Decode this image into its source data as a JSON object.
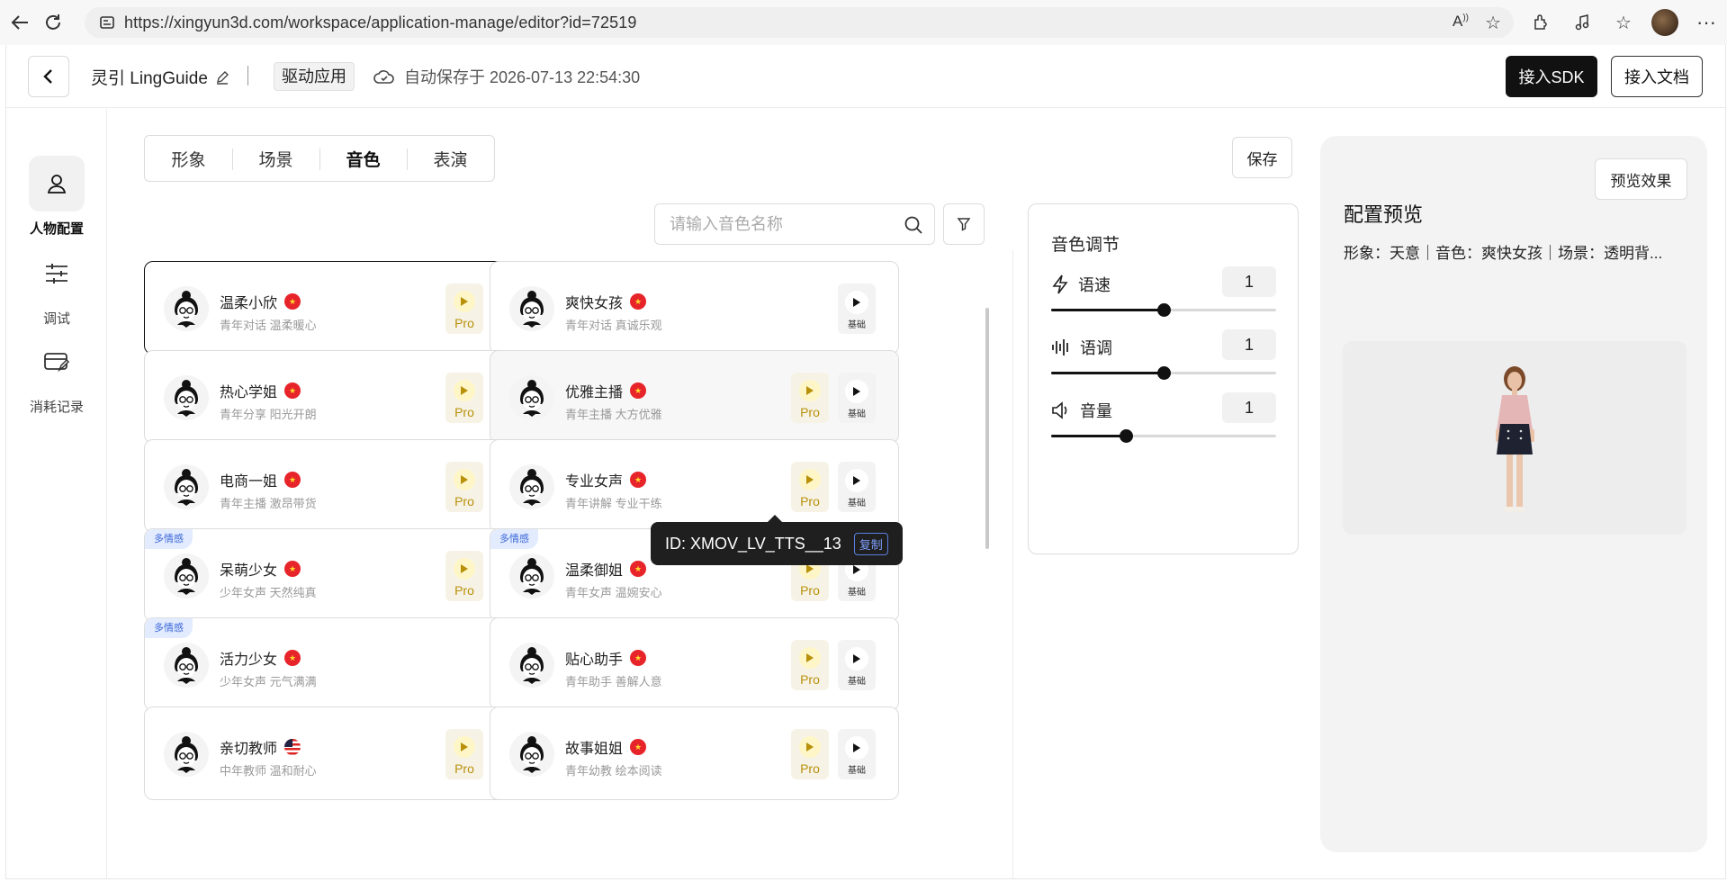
{
  "browser": {
    "url": "https://xingyun3d.com/workspace/application-manage/editor?id=72519"
  },
  "header": {
    "app_name": "灵引 LingGuide",
    "tag": "驱动应用",
    "autosave": "自动保存于 2026-07-13 22:54:30",
    "sdk_button": "接入SDK",
    "doc_button": "接入文档"
  },
  "left_nav": {
    "items": [
      {
        "label": "人物配置",
        "icon": "person-icon",
        "active": true
      },
      {
        "label": "调试",
        "icon": "sliders-icon",
        "active": false
      },
      {
        "label": "消耗记录",
        "icon": "card-edit-icon",
        "active": false
      }
    ]
  },
  "tabs": [
    {
      "label": "形象",
      "active": false
    },
    {
      "label": "场景",
      "active": false
    },
    {
      "label": "音色",
      "active": true
    },
    {
      "label": "表演",
      "active": false
    }
  ],
  "save_button": "保存",
  "search": {
    "placeholder": "请输入音色名称",
    "value": ""
  },
  "voices": [
    {
      "name": "温柔小欣",
      "desc": "青年对话 温柔暖心",
      "flag": "cn",
      "pro": true,
      "multi": false,
      "selected": true,
      "playing": true
    },
    {
      "name": "爽快女孩",
      "desc": "青年对话 真诚乐观",
      "flag": "cn",
      "pro": false,
      "multi": false
    },
    {
      "name": "热心学姐",
      "desc": "青年分享 阳光开朗",
      "flag": "cn",
      "pro": true,
      "multi": false
    },
    {
      "name": "优雅主播",
      "desc": "青年主播 大方优雅",
      "flag": "cn",
      "pro": true,
      "multi": false,
      "hover": true
    },
    {
      "name": "电商一姐",
      "desc": "青年主播 激昂带货",
      "flag": "cn",
      "pro": true,
      "multi": false
    },
    {
      "name": "专业女声",
      "desc": "青年讲解 专业干练",
      "flag": "cn",
      "pro": true,
      "multi": false
    },
    {
      "name": "呆萌少女",
      "desc": "少年女声 天然纯真",
      "flag": "cn",
      "pro": true,
      "multi": true
    },
    {
      "name": "温柔御姐",
      "desc": "青年女声 温婉安心",
      "flag": "cn",
      "pro": true,
      "multi": true
    },
    {
      "name": "活力少女",
      "desc": "少年女声 元气满满",
      "flag": "cn",
      "pro": false,
      "multi": true
    },
    {
      "name": "贴心助手",
      "desc": "青年助手 善解人意",
      "flag": "cn",
      "pro": true,
      "multi": false
    },
    {
      "name": "亲切教师",
      "desc": "中年教师 温和耐心",
      "flag": "us",
      "pro": true,
      "multi": false
    },
    {
      "name": "故事姐姐",
      "desc": "青年幼教 绘本阅读",
      "flag": "cn",
      "pro": true,
      "multi": false
    }
  ],
  "labels": {
    "pro": "Pro",
    "base": "基础",
    "multi": "多情感"
  },
  "tooltip": {
    "id_text": "ID: XMOV_LV_TTS__13",
    "copy": "复制"
  },
  "adjust": {
    "title": "音色调节",
    "rows": [
      {
        "label": "语速",
        "value": "1",
        "icon": "lightning-icon",
        "level": 0.5
      },
      {
        "label": "语调",
        "value": "1",
        "icon": "waveform-icon",
        "level": 0.5
      },
      {
        "label": "音量",
        "value": "1",
        "icon": "speaker-icon",
        "level": 0.33
      }
    ]
  },
  "preview": {
    "button": "预览效果",
    "title": "配置预览",
    "summary": "形象：天意｜音色：爽快女孩｜场景：透明背..."
  }
}
